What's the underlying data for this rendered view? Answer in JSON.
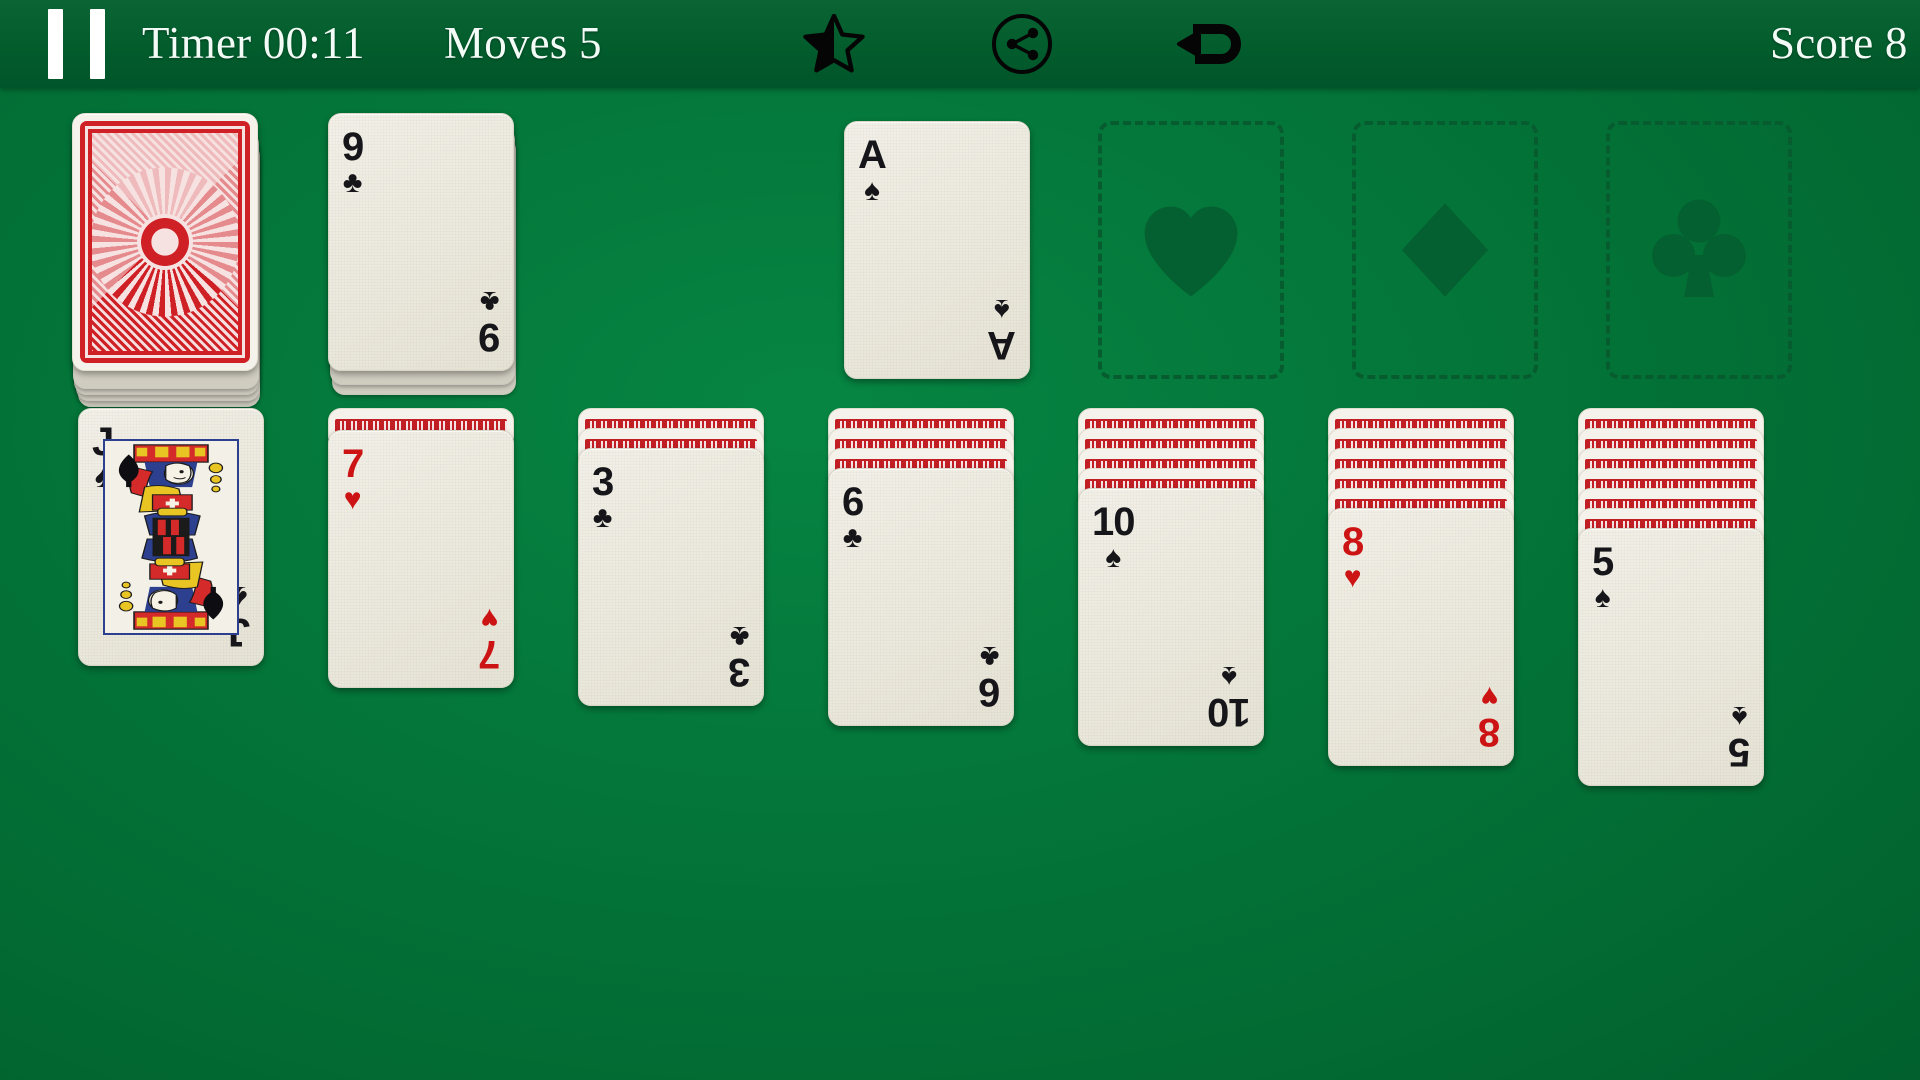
{
  "header": {
    "pause_label": "pause",
    "timer_label": "Timer 00:11",
    "moves_label": "Moves 5",
    "score_label": "Score 8",
    "star_icon": "half-star-icon",
    "share_icon": "share-icon",
    "undo_icon": "undo-icon",
    "bg_color": "#025C2C",
    "text_color": "#F3FBF6"
  },
  "board": {
    "felt_color": "#04773A",
    "slot_border_color": "#075C2F",
    "slot_suit_color": "#046030"
  },
  "stock": {
    "name": "stock-pile",
    "face_down": true,
    "layers": 5
  },
  "waste": {
    "name": "waste-pile",
    "rank": "9",
    "suit": "♣",
    "suit_name": "clubs",
    "color": "black",
    "layers": 3
  },
  "foundations": [
    {
      "name": "foundation-spades",
      "empty": false,
      "rank": "A",
      "suit": "♠",
      "suit_name": "spades",
      "color": "black"
    },
    {
      "name": "foundation-hearts",
      "empty": true,
      "suit_name": "hearts"
    },
    {
      "name": "foundation-diamonds",
      "empty": true,
      "suit_name": "diamonds"
    },
    {
      "name": "foundation-clubs",
      "empty": true,
      "suit_name": "clubs"
    }
  ],
  "tableau": [
    {
      "name": "tableau-column-1",
      "down": 0,
      "rank": "J",
      "suit": "♠",
      "suit_name": "spades",
      "color": "black",
      "court": true
    },
    {
      "name": "tableau-column-2",
      "down": 1,
      "rank": "7",
      "suit": "♥",
      "suit_name": "hearts",
      "color": "red",
      "court": false
    },
    {
      "name": "tableau-column-3",
      "down": 2,
      "rank": "3",
      "suit": "♣",
      "suit_name": "clubs",
      "color": "black",
      "court": false
    },
    {
      "name": "tableau-column-4",
      "down": 3,
      "rank": "6",
      "suit": "♣",
      "suit_name": "clubs",
      "color": "black",
      "court": false
    },
    {
      "name": "tableau-column-5",
      "down": 4,
      "rank": "10",
      "suit": "♠",
      "suit_name": "spades",
      "color": "black",
      "court": false
    },
    {
      "name": "tableau-column-6",
      "down": 5,
      "rank": "8",
      "suit": "♥",
      "suit_name": "hearts",
      "color": "red",
      "court": false
    },
    {
      "name": "tableau-column-7",
      "down": 6,
      "rank": "5",
      "suit": "♠",
      "suit_name": "spades",
      "color": "black",
      "court": false
    }
  ]
}
